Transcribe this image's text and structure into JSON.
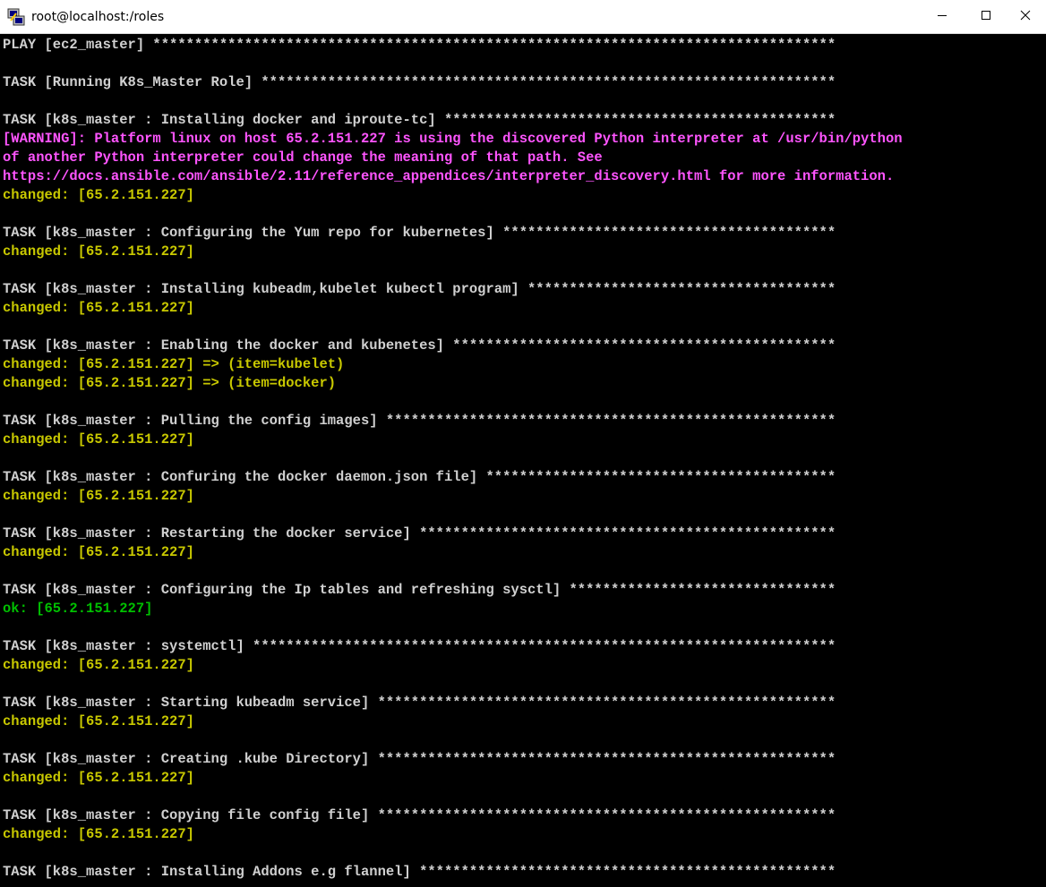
{
  "window": {
    "title": "root@localhost:/roles",
    "icons": {
      "app": "putty-terminal-icon",
      "minimize": "minimize-icon",
      "maximize": "maximize-icon",
      "close": "close-icon"
    }
  },
  "colors": {
    "background": "#000000",
    "task_text": "#d0d0d0",
    "warning": "#ff55ff",
    "changed": "#c8c800",
    "ok": "#00c000"
  },
  "terminal": {
    "lines": [
      {
        "text": "PLAY [ec2_master] **********************************************************************************",
        "kind": "play"
      },
      {
        "text": "",
        "kind": "blank"
      },
      {
        "text": "TASK [Running K8s_Master Role] *********************************************************************",
        "kind": "task"
      },
      {
        "text": "",
        "kind": "blank"
      },
      {
        "text": "TASK [k8s_master : Installing docker and iproute-tc] ***********************************************",
        "kind": "task"
      },
      {
        "text": "[WARNING]: Platform linux on host 65.2.151.227 is using the discovered Python interpreter at /usr/bin/python",
        "kind": "warning"
      },
      {
        "text": "of another Python interpreter could change the meaning of that path. See",
        "kind": "warning"
      },
      {
        "text": "https://docs.ansible.com/ansible/2.11/reference_appendices/interpreter_discovery.html for more information.",
        "kind": "warning"
      },
      {
        "text": "changed: [65.2.151.227]",
        "kind": "changed"
      },
      {
        "text": "",
        "kind": "blank"
      },
      {
        "text": "TASK [k8s_master : Configuring the Yum repo for kubernetes] ****************************************",
        "kind": "task"
      },
      {
        "text": "changed: [65.2.151.227]",
        "kind": "changed"
      },
      {
        "text": "",
        "kind": "blank"
      },
      {
        "text": "TASK [k8s_master : Installing kubeadm,kubelet kubectl program] *************************************",
        "kind": "task"
      },
      {
        "text": "changed: [65.2.151.227]",
        "kind": "changed"
      },
      {
        "text": "",
        "kind": "blank"
      },
      {
        "text": "TASK [k8s_master : Enabling the docker and kubenetes] **********************************************",
        "kind": "task"
      },
      {
        "text": "changed: [65.2.151.227] => (item=kubelet)",
        "kind": "changed"
      },
      {
        "text": "changed: [65.2.151.227] => (item=docker)",
        "kind": "changed"
      },
      {
        "text": "",
        "kind": "blank"
      },
      {
        "text": "TASK [k8s_master : Pulling the config images] ******************************************************",
        "kind": "task"
      },
      {
        "text": "changed: [65.2.151.227]",
        "kind": "changed"
      },
      {
        "text": "",
        "kind": "blank"
      },
      {
        "text": "TASK [k8s_master : Confuring the docker daemon.json file] ******************************************",
        "kind": "task"
      },
      {
        "text": "changed: [65.2.151.227]",
        "kind": "changed"
      },
      {
        "text": "",
        "kind": "blank"
      },
      {
        "text": "TASK [k8s_master : Restarting the docker service] **************************************************",
        "kind": "task"
      },
      {
        "text": "changed: [65.2.151.227]",
        "kind": "changed"
      },
      {
        "text": "",
        "kind": "blank"
      },
      {
        "text": "TASK [k8s_master : Configuring the Ip tables and refreshing sysctl] ********************************",
        "kind": "task"
      },
      {
        "text": "ok: [65.2.151.227]",
        "kind": "ok"
      },
      {
        "text": "",
        "kind": "blank"
      },
      {
        "text": "TASK [k8s_master : systemctl] **********************************************************************",
        "kind": "task"
      },
      {
        "text": "changed: [65.2.151.227]",
        "kind": "changed"
      },
      {
        "text": "",
        "kind": "blank"
      },
      {
        "text": "TASK [k8s_master : Starting kubeadm service] *******************************************************",
        "kind": "task"
      },
      {
        "text": "changed: [65.2.151.227]",
        "kind": "changed"
      },
      {
        "text": "",
        "kind": "blank"
      },
      {
        "text": "TASK [k8s_master : Creating .kube Directory] *******************************************************",
        "kind": "task"
      },
      {
        "text": "changed: [65.2.151.227]",
        "kind": "changed"
      },
      {
        "text": "",
        "kind": "blank"
      },
      {
        "text": "TASK [k8s_master : Copying file config file] *******************************************************",
        "kind": "task"
      },
      {
        "text": "changed: [65.2.151.227]",
        "kind": "changed"
      },
      {
        "text": "",
        "kind": "blank"
      },
      {
        "text": "TASK [k8s_master : Installing Addons e.g flannel] **************************************************",
        "kind": "task"
      }
    ]
  }
}
